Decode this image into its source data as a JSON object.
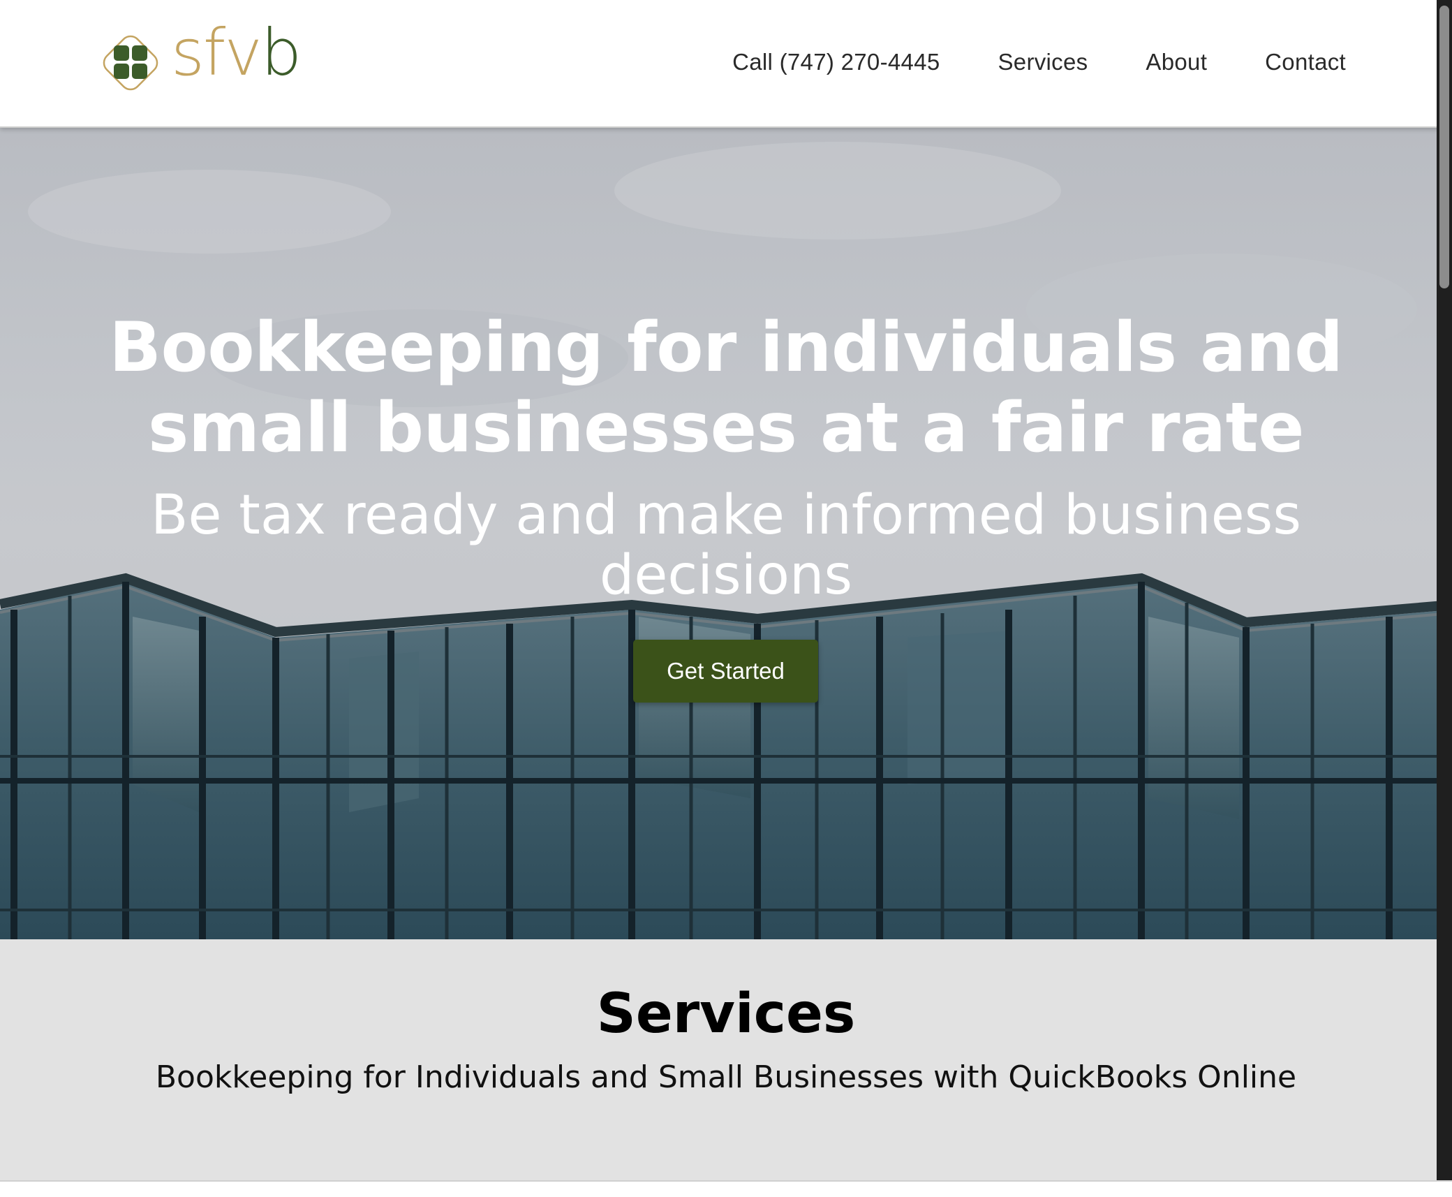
{
  "logo": {
    "text_gold": "sfv",
    "text_green": "b",
    "colors": {
      "gold": "#c4a461",
      "green": "#3c5c2a"
    }
  },
  "nav": {
    "call": "Call (747) 270-4445",
    "services": "Services",
    "about": "About",
    "contact": "Contact"
  },
  "hero": {
    "heading_line1": "Bookkeeping for individuals and",
    "heading_line2": "small businesses at a fair rate",
    "sub_line1": "Be tax ready and make informed business",
    "sub_line2": "decisions",
    "cta": "Get Started",
    "cta_color": "#3b5219"
  },
  "services": {
    "title": "Services",
    "description": "Bookkeeping for Individuals and Small Businesses with QuickBooks Online"
  }
}
